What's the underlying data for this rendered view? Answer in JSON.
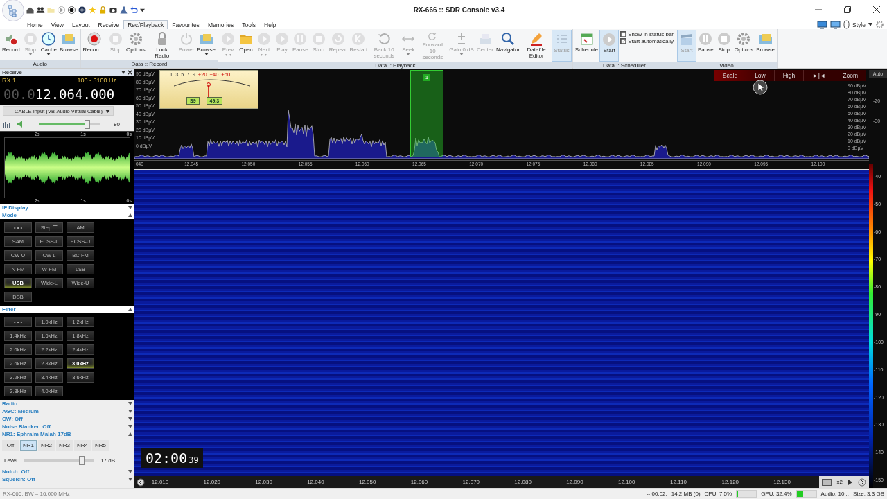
{
  "window": {
    "title": "RX-666 :: SDR Console v3.4"
  },
  "menu": [
    {
      "label": "Home",
      "selected": false
    },
    {
      "label": "View",
      "selected": false
    },
    {
      "label": "Layout",
      "selected": false
    },
    {
      "label": "Receive",
      "selected": false
    },
    {
      "label": "Rec/Playback",
      "selected": true
    },
    {
      "label": "Favourites",
      "selected": false
    },
    {
      "label": "Memories",
      "selected": false
    },
    {
      "label": "Tools",
      "selected": false
    },
    {
      "label": "Help",
      "selected": false
    }
  ],
  "style_menu": "Style",
  "ribbon": [
    {
      "label": "Audio",
      "items": [
        {
          "kind": "speaker",
          "label": "Record",
          "disabled": false,
          "active": false,
          "dropdown": false
        },
        {
          "kind": "stop",
          "label": "Stop",
          "disabled": true,
          "active": false,
          "dropdown": true
        },
        {
          "kind": "clock",
          "label": "Cache",
          "disabled": false,
          "active": false,
          "dropdown": true
        },
        {
          "kind": "browse",
          "label": "Browse",
          "disabled": false,
          "active": false,
          "dropdown": false
        }
      ]
    },
    {
      "label": "Data :: Record",
      "items": [
        {
          "kind": "record",
          "label": "Record...",
          "disabled": false,
          "active": false,
          "dropdown": false
        },
        {
          "kind": "stop",
          "label": "Stop",
          "disabled": true,
          "active": false,
          "dropdown": false
        },
        {
          "kind": "gear",
          "label": "Options",
          "disabled": false,
          "active": false,
          "dropdown": false
        },
        {
          "kind": "lock",
          "label": "Lock Radio",
          "disabled": false,
          "active": false,
          "dropdown": false
        },
        {
          "kind": "power",
          "label": "Power",
          "disabled": true,
          "active": false,
          "dropdown": false
        },
        {
          "kind": "browse",
          "label": "Browse",
          "disabled": false,
          "active": false,
          "dropdown": true
        }
      ]
    },
    {
      "label": "Data :: Playback",
      "items": [
        {
          "kind": "play",
          "label": "Prev",
          "sub": "◄◄",
          "disabled": true,
          "active": false,
          "dropdown": false
        },
        {
          "kind": "folder",
          "label": "Open",
          "disabled": false,
          "active": false,
          "dropdown": false
        },
        {
          "kind": "play",
          "label": "Next",
          "sub": "►►",
          "disabled": true,
          "active": false,
          "dropdown": false
        },
        {
          "kind": "play",
          "label": "Play",
          "disabled": true,
          "active": false,
          "dropdown": false
        },
        {
          "kind": "pause",
          "label": "Pause",
          "disabled": true,
          "active": false,
          "dropdown": false
        },
        {
          "kind": "stop",
          "label": "Stop",
          "disabled": true,
          "active": false,
          "dropdown": false
        },
        {
          "kind": "repeat",
          "label": "Repeat",
          "disabled": true,
          "active": false,
          "dropdown": false
        },
        {
          "kind": "restart",
          "label": "Restart",
          "disabled": true,
          "active": false,
          "dropdown": false
        },
        {
          "kind": "back",
          "label": "Back 10 seconds",
          "disabled": true,
          "active": false,
          "dropdown": false
        },
        {
          "kind": "seek",
          "label": "Seek",
          "disabled": true,
          "active": false,
          "dropdown": true
        },
        {
          "kind": "forward",
          "label": "Forward 10 seconds",
          "disabled": true,
          "active": false,
          "dropdown": false
        },
        {
          "kind": "gain",
          "label": "Gain 0 dB",
          "disabled": true,
          "active": false,
          "dropdown": true
        },
        {
          "kind": "center",
          "label": "Center",
          "disabled": true,
          "active": false,
          "dropdown": false
        },
        {
          "kind": "search",
          "label": "Navigator",
          "disabled": false,
          "active": false,
          "dropdown": false
        },
        {
          "kind": "pencil",
          "label": "Datafile Editor",
          "disabled": false,
          "active": false,
          "dropdown": false
        },
        {
          "kind": "list",
          "label": "Status",
          "disabled": true,
          "active": true,
          "dropdown": false
        }
      ]
    },
    {
      "label": "Data :: Scheduler",
      "items": [
        {
          "kind": "calendar",
          "label": "Schedule",
          "disabled": false,
          "active": false,
          "dropdown": false
        },
        {
          "kind": "play",
          "label": "Start",
          "disabled": false,
          "active": true,
          "dropdown": false
        }
      ],
      "checkboxes": [
        {
          "label": "Show in status bar",
          "checked": false
        },
        {
          "label": "Start automatically",
          "checked": true
        }
      ]
    },
    {
      "label": "Video",
      "items": [
        {
          "kind": "clapper",
          "label": "Start",
          "disabled": true,
          "active": true,
          "dropdown": false
        },
        {
          "kind": "pause",
          "label": "Pause",
          "disabled": false,
          "active": false,
          "dropdown": false
        },
        {
          "kind": "stop",
          "label": "Stop",
          "disabled": false,
          "active": false,
          "dropdown": false
        },
        {
          "kind": "gear",
          "label": "Options",
          "disabled": false,
          "active": false,
          "dropdown": false
        },
        {
          "kind": "browse",
          "label": "Browse",
          "disabled": false,
          "active": false,
          "dropdown": false
        }
      ]
    }
  ],
  "receive": {
    "title": "Receive",
    "rx": "RX 1",
    "range": "100 - 3100 Hz",
    "freq_dim": "00.0",
    "freq": "12.064.000",
    "input": "CABLE Input (VB-Audio Virtual Cable)",
    "volume": {
      "level": 0.8,
      "reading": "80"
    },
    "waveform_ticks_top": [
      "2s",
      "1s",
      "0s"
    ],
    "waveform_ticks_bottom": [
      "2s",
      "1s",
      "0s"
    ],
    "sections_top": [
      {
        "label": "IF Display",
        "expanded": false
      },
      {
        "label": "Mode",
        "expanded": true
      }
    ],
    "modes": [
      {
        "label": "• • •",
        "selected": false
      },
      {
        "label": "Step ☰",
        "selected": false
      },
      {
        "label": "AM",
        "selected": false
      },
      {
        "label": "SAM",
        "selected": false
      },
      {
        "label": "ECSS-L",
        "selected": false
      },
      {
        "label": "ECSS-U",
        "selected": false
      },
      {
        "label": "CW-U",
        "selected": false
      },
      {
        "label": "CW-L",
        "selected": false
      },
      {
        "label": "BC-FM",
        "selected": false
      },
      {
        "label": "N-FM",
        "selected": false
      },
      {
        "label": "W-FM",
        "selected": false
      },
      {
        "label": "LSB",
        "selected": false
      },
      {
        "label": "USB",
        "selected": true
      },
      {
        "label": "Wide-L",
        "selected": false
      },
      {
        "label": "Wide-U",
        "selected": false
      },
      {
        "label": "DSB",
        "selected": false
      }
    ],
    "filter_section": {
      "label": "Filter",
      "expanded": true
    },
    "filters": [
      {
        "label": "• • •",
        "selected": false
      },
      {
        "label": "1.0kHz",
        "selected": false
      },
      {
        "label": "1.2kHz",
        "selected": false
      },
      {
        "label": "1.4kHz",
        "selected": false
      },
      {
        "label": "1.6kHz",
        "selected": false
      },
      {
        "label": "1.8kHz",
        "selected": false
      },
      {
        "label": "2.0kHz",
        "selected": false
      },
      {
        "label": "2.2kHz",
        "selected": false
      },
      {
        "label": "2.4kHz",
        "selected": false
      },
      {
        "label": "2.6kHz",
        "selected": false
      },
      {
        "label": "2.8kHz",
        "selected": false
      },
      {
        "label": "3.0kHz",
        "selected": true
      },
      {
        "label": "3.2kHz",
        "selected": false
      },
      {
        "label": "3.4kHz",
        "selected": false
      },
      {
        "label": "3.6kHz",
        "selected": false
      },
      {
        "label": "3.8kHz",
        "selected": false
      },
      {
        "label": "4.0kHz",
        "selected": false
      }
    ],
    "sections_mid": [
      {
        "label": "Radio",
        "expanded": false
      },
      {
        "label": "AGC: Medium",
        "expanded": false
      },
      {
        "label": "CW: Off",
        "expanded": false
      },
      {
        "label": "Noise Blanker: Off",
        "expanded": false
      },
      {
        "label": "NR1: Ephraim Malah 17dB",
        "expanded": true
      }
    ],
    "nr": [
      {
        "label": "Off",
        "selected": false
      },
      {
        "label": "NR1",
        "selected": true
      },
      {
        "label": "NR2",
        "selected": false
      },
      {
        "label": "NR3",
        "selected": false
      },
      {
        "label": "NR4",
        "selected": false
      },
      {
        "label": "NR5",
        "selected": false
      }
    ],
    "nr_level": {
      "label": "Level",
      "level": 0.83,
      "reading": "17 dB"
    },
    "sections_bottom": [
      {
        "label": "Notch: Off",
        "expanded": false
      },
      {
        "label": "Squelch: Off",
        "expanded": false
      }
    ]
  },
  "spectrum": {
    "db_labels_left": [
      "90 dBµV",
      "80 dBµV",
      "70 dBµV",
      "60 dBµV",
      "50 dBµV",
      "40 dBµV",
      "30 dBµV",
      "20 dBµV",
      "10 dBµV",
      "0 dBµV"
    ],
    "db_labels_right": [
      "90 dBµV",
      "80 dBµV",
      "70 dBµV",
      "60 dBµV",
      "50 dBµV",
      "40 dBµV",
      "30 dBµV",
      "20 dBµV",
      "10 dBµV",
      "0 dBµV"
    ],
    "ticks": [
      "040",
      "12.045",
      "12.050",
      "12.055",
      "12.060",
      "12.065",
      "12.070",
      "12.075",
      "12.080",
      "12.085",
      "12.090",
      "12.095",
      "12.100"
    ],
    "marker": "1",
    "smeter": {
      "scale": [
        "1",
        "3",
        "5",
        "7",
        "9",
        "+20",
        "+40",
        "+60"
      ],
      "s_reading": "S9",
      "value": "49.3"
    },
    "controls": [
      "Scale",
      "Low",
      "High",
      "►|◄",
      "Zoom"
    ],
    "auto": "Auto",
    "right_labels": [
      "-20",
      "-30"
    ]
  },
  "waterfall": {
    "time": "02:00",
    "seconds": "39",
    "colorbar_labels": [
      "-40",
      "-50",
      "-60",
      "-70",
      "-80",
      "-90",
      "-100",
      "-110",
      "-120",
      "-130",
      "-140",
      "-150"
    ],
    "ticks": [
      "12.010",
      "12.020",
      "12.030",
      "12.040",
      "12.050",
      "12.060",
      "12.070",
      "12.080",
      "12.090",
      "12.100",
      "12.110",
      "12.120",
      "12.130"
    ],
    "zoom": "x2"
  },
  "status_bar": {
    "left": "RX-666, BW = 16.000 MHz",
    "items": [
      {
        "label": "--:00:02,"
      },
      {
        "label": "14.2 MB (0)"
      },
      {
        "label": "CPU: 7.5%",
        "level": 0.08
      },
      {
        "label": "GPU: 32.4%",
        "level": 0.32
      },
      {
        "label": "Audio: 10..."
      },
      {
        "label": "Size: 3.3 GB"
      }
    ]
  }
}
